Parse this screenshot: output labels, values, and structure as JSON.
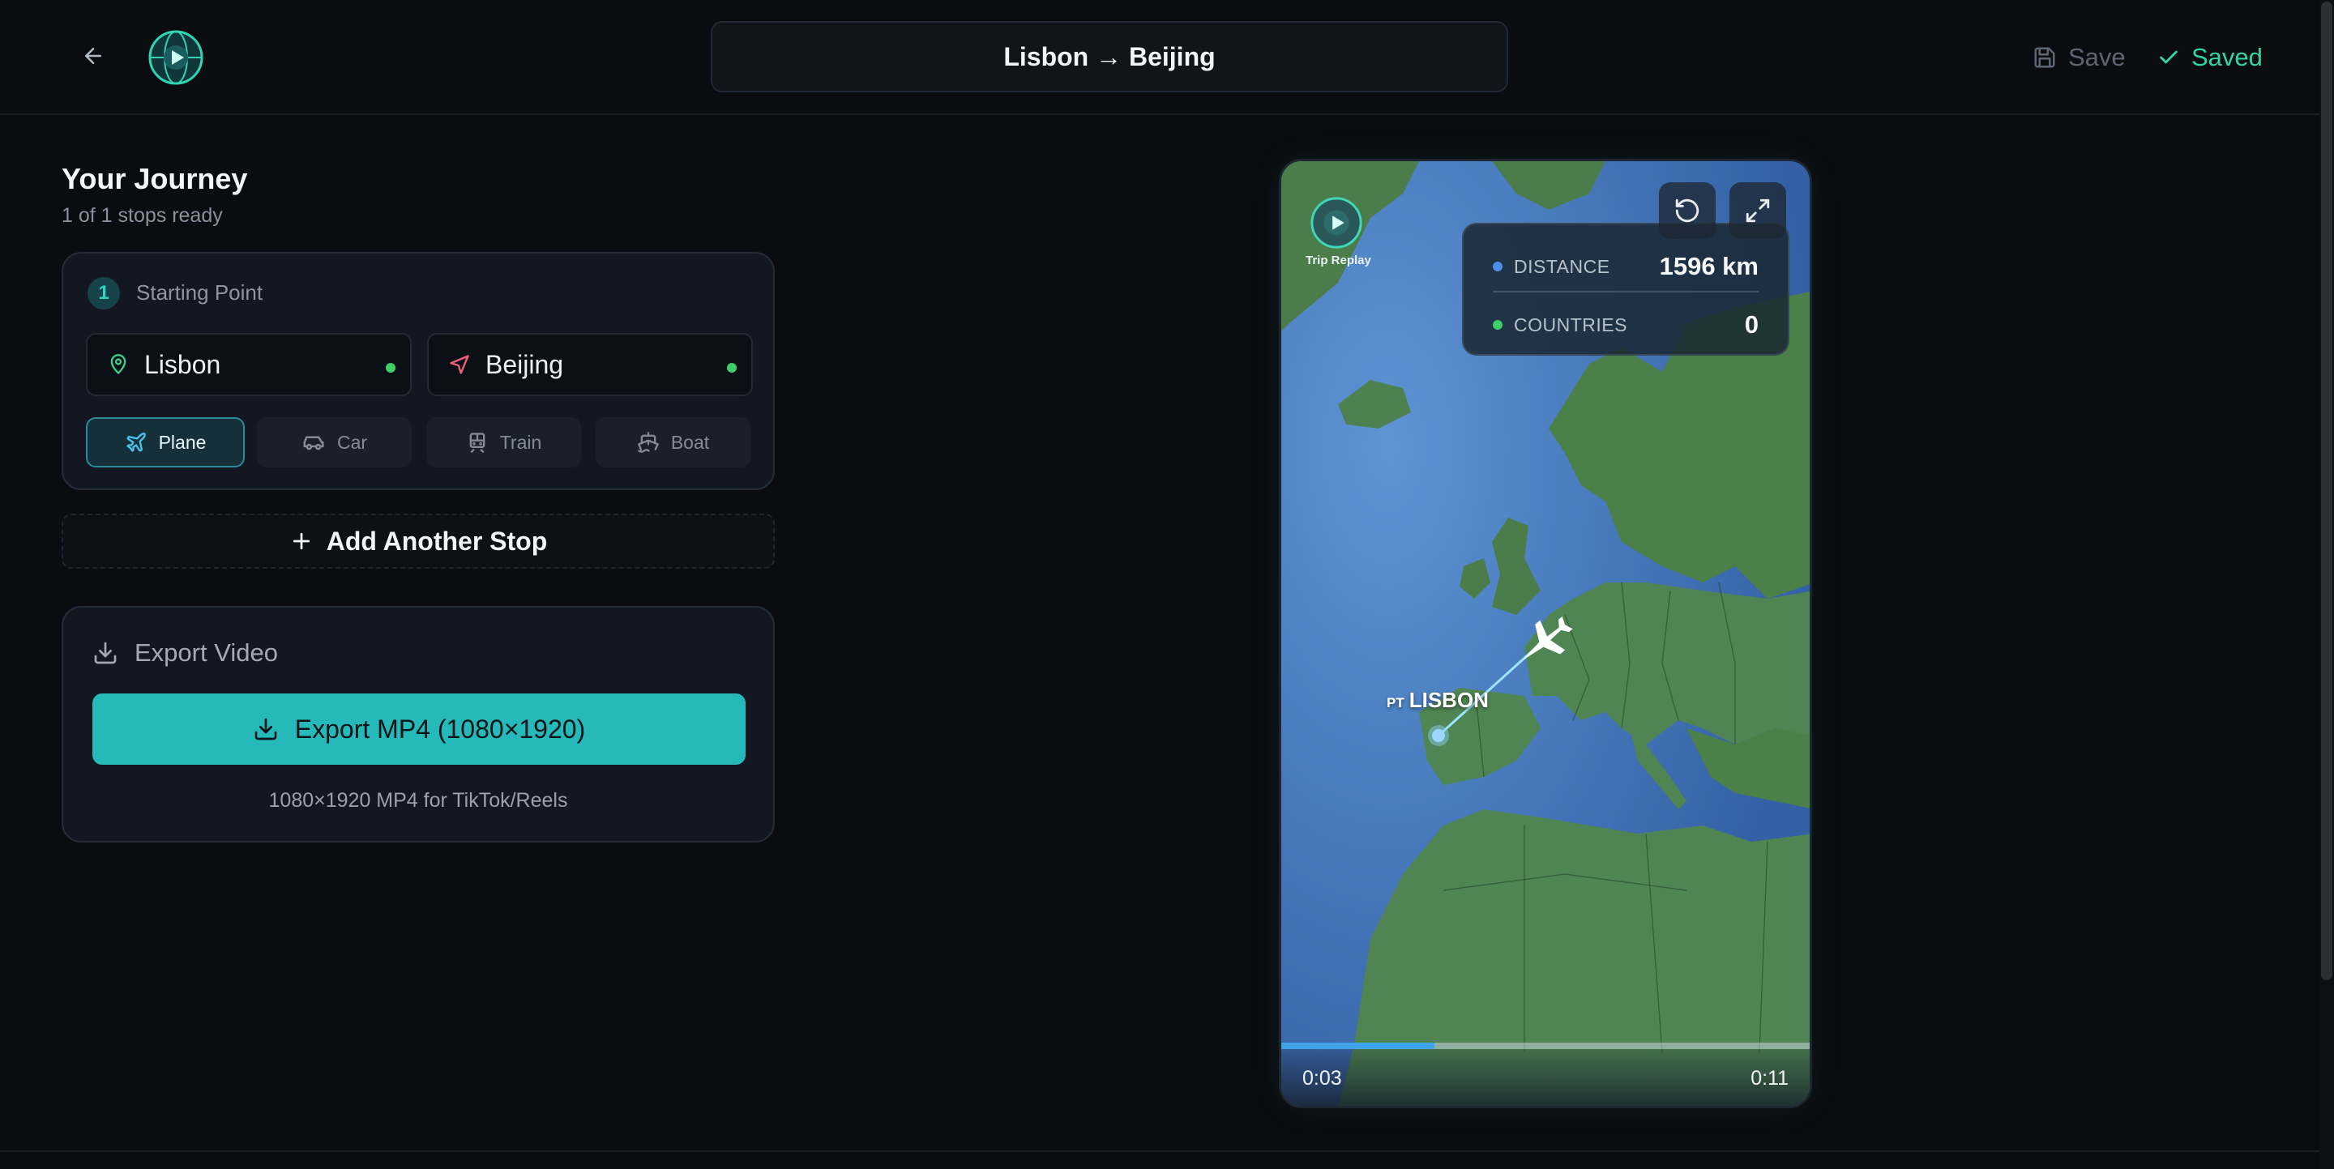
{
  "header": {
    "title": "Lisbon → Beijing",
    "save_label": "Save",
    "saved_label": "Saved",
    "icons": {
      "back": "arrow-left-icon",
      "logo": "globe-play-icon",
      "save": "floppy-disk-icon",
      "saved": "check-icon"
    }
  },
  "journey": {
    "title": "Your Journey",
    "subtitle": "1 of 1 stops ready",
    "stops": [
      {
        "number": "1",
        "label": "Starting Point",
        "from": "Lisbon",
        "to": "Beijing",
        "modes": [
          {
            "label": "Plane",
            "icon": "plane-icon",
            "active": true
          },
          {
            "label": "Car",
            "icon": "car-icon",
            "active": false
          },
          {
            "label": "Train",
            "icon": "train-icon",
            "active": false
          },
          {
            "label": "Boat",
            "icon": "boat-icon",
            "active": false
          }
        ]
      }
    ],
    "add_stop_label": "Add Another Stop"
  },
  "export": {
    "title": "Export Video",
    "button_label": "Export MP4 (1080×1920)",
    "note": "1080×1920 MP4 for TikTok/Reels"
  },
  "preview": {
    "brand": "Trip Replay",
    "stats": {
      "distance_label": "DISTANCE",
      "distance_value": "1596 km",
      "countries_label": "COUNTRIES",
      "countries_value": "0"
    },
    "city_label": "LISBON",
    "city_country_code": "PT",
    "current_time": "0:03",
    "total_time": "0:11",
    "progress": 0.29
  },
  "colors": {
    "accent": "#26b9ba",
    "saved_green": "#2fd5a3",
    "status_dot": "#3ecf6a",
    "distance_dot": "#4f8de8",
    "countries_dot": "#3ecf6a"
  }
}
